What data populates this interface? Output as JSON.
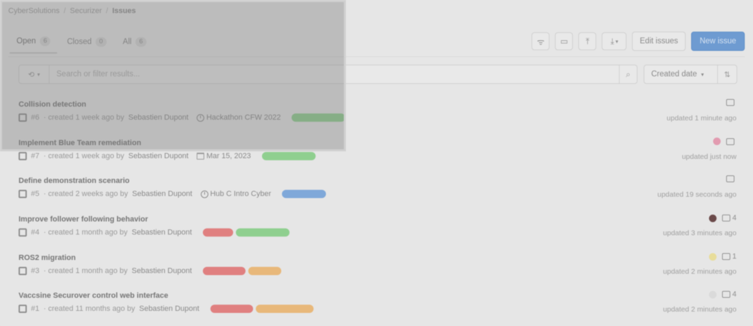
{
  "breadcrumb": [
    "CyberSolutions",
    "Securizer",
    "Issues"
  ],
  "tabs": [
    {
      "label": "Open",
      "count": "6"
    },
    {
      "label": "Closed",
      "count": "0"
    },
    {
      "label": "All",
      "count": "6"
    }
  ],
  "actions": {
    "edit_issues": "Edit issues",
    "new_issue": "New issue",
    "icons": [
      "rss-icon",
      "calendar-icon",
      "upload-icon",
      "download-icon"
    ]
  },
  "filter": {
    "placeholder": "Search or filter results...",
    "history_icon": "history-icon",
    "search_icon": "search-icon"
  },
  "sort": {
    "label": "Created date",
    "direction_icon": "sort-direction-icon"
  },
  "issues": [
    {
      "title": "Collision detection",
      "id": "#6",
      "created": "· created 1 week ago by",
      "author": "Sebastien Dupont",
      "milestone": "Hackathon CFW 2022",
      "milestone_icon": "clock-icon",
      "labels": [
        {
          "color": "#8fcf8f",
          "width": 78
        }
      ],
      "assignee_color": "",
      "comments": "",
      "updated": "updated 1 minute ago"
    },
    {
      "title": "Implement Blue Team remediation",
      "id": "#7",
      "created": "· created 1 week ago by",
      "author": "Sebastien Dupont",
      "milestone": "Mar 15, 2023",
      "milestone_icon": "calendar-icon",
      "labels": [
        {
          "color": "#8fcf8f",
          "width": 78
        }
      ],
      "assignee_color": "#e29bb0",
      "comments": "",
      "updated": "updated just now"
    },
    {
      "title": "Define demonstration scenario",
      "id": "#5",
      "created": "· created 2 weeks ago by",
      "author": "Sebastien Dupont",
      "milestone": "Hub C Intro Cyber",
      "milestone_icon": "clock-icon",
      "labels": [
        {
          "color": "#7fa8d9",
          "width": 64
        }
      ],
      "assignee_color": "",
      "comments": "",
      "updated": "updated 19 seconds ago"
    },
    {
      "title": "Improve follower following behavior",
      "id": "#4",
      "created": "· created 1 month ago by",
      "author": "Sebastien Dupont",
      "milestone": "",
      "milestone_icon": "",
      "labels": [
        {
          "color": "#e08080",
          "width": 44
        },
        {
          "color": "#8fcf8f",
          "width": 78
        }
      ],
      "assignee_color": "#6b4a4a",
      "comments": "4",
      "updated": "updated 3 minutes ago"
    },
    {
      "title": "ROS2 migration",
      "id": "#3",
      "created": "· created 1 month ago by",
      "author": "Sebastien Dupont",
      "milestone": "",
      "milestone_icon": "",
      "labels": [
        {
          "color": "#e08080",
          "width": 62
        },
        {
          "color": "#e8b87a",
          "width": 48
        }
      ],
      "assignee_color": "#e8dd9a",
      "comments": "1",
      "updated": "updated 2 minutes ago"
    },
    {
      "title": "Vaccsine Securover control web interface",
      "id": "#1",
      "created": "· created 11 months ago by",
      "author": "Sebastien Dupont",
      "milestone": "",
      "milestone_icon": "",
      "labels": [
        {
          "color": "#e08080",
          "width": 62
        },
        {
          "color": "#e8b87a",
          "width": 84
        }
      ],
      "assignee_color": "#dadada",
      "comments": "4",
      "updated": "updated 2 minutes ago"
    }
  ]
}
